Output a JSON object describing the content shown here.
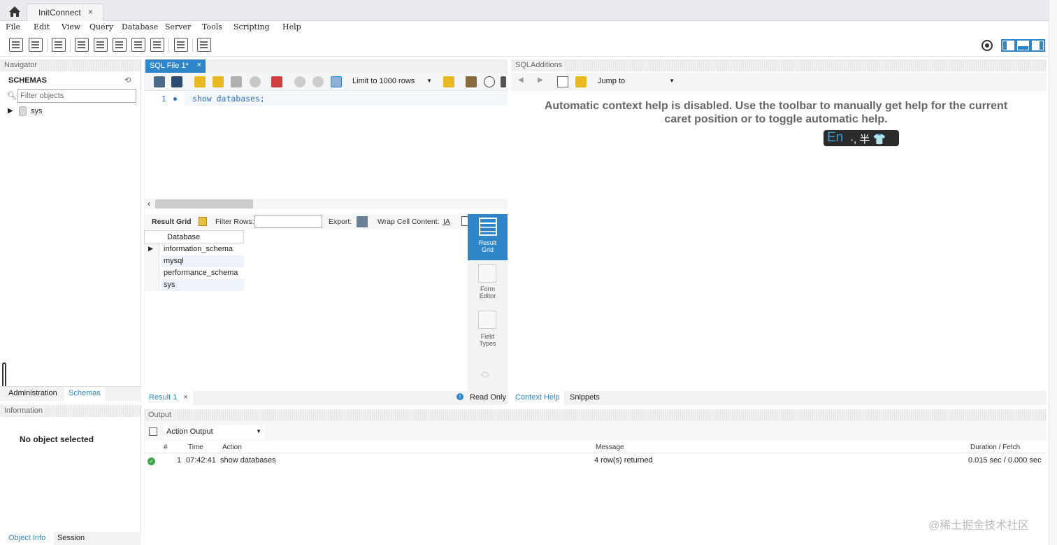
{
  "tabbar": {
    "connection_tab": "InitConnect",
    "close_glyph": "×"
  },
  "menu": [
    "File",
    "Edit",
    "View",
    "Query",
    "Database",
    "Server",
    "Tools",
    "Scripting",
    "Help"
  ],
  "navigator": {
    "header": "Navigator",
    "schemas_title": "SCHEMAS",
    "filter_placeholder": "Filter objects",
    "schemas": [
      "sys"
    ],
    "tabs": [
      "Administration",
      "Schemas"
    ]
  },
  "information": {
    "header": "Information",
    "message": "No object selected",
    "tabs": [
      "Object Info",
      "Session"
    ]
  },
  "editor": {
    "tab_label": "SQL File 1*",
    "tab_close": "×",
    "limit_select": "Limit to 1000 rows",
    "line_number": "1",
    "code": "show databases;"
  },
  "result": {
    "toolbar": {
      "result_grid": "Result Grid",
      "filter_rows": "Filter Rows:",
      "export": "Export:",
      "wrap_cell": "Wrap Cell Content:"
    },
    "column_header": "Database",
    "rows": [
      "information_schema",
      "mysql",
      "performance_schema",
      "sys"
    ],
    "side_panel": [
      "Result Grid",
      "Form Editor",
      "Field Types"
    ],
    "tab_label": "Result 1",
    "read_only": "Read Only"
  },
  "sql_additions": {
    "header": "SQLAdditions",
    "jump_to": "Jump to",
    "context_help_line1": "Automatic context help is disabled. Use the toolbar to manually get help for the current",
    "context_help_line2": "caret position or to toggle automatic help.",
    "tabs": [
      "Context Help",
      "Snippets"
    ]
  },
  "ime": {
    "lang": "En",
    "rest": "·, 半 👕"
  },
  "output": {
    "header": "Output",
    "select": "Action Output",
    "columns": [
      "#",
      "Time",
      "Action",
      "Message",
      "Duration / Fetch"
    ],
    "rows": [
      {
        "num": "1",
        "time": "07:42:41",
        "action": "show databases",
        "message": "4 row(s) returned",
        "duration": "0.015 sec / 0.000 sec"
      }
    ]
  },
  "watermark": "@稀土掘金技术社区",
  "colors": {
    "accent": "#2e86c9",
    "success": "#3ba54a",
    "link": "#2f6fbf"
  }
}
